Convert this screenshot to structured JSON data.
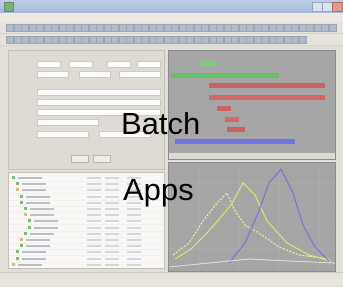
{
  "overlay": {
    "line1": "Batch",
    "line2": "Apps"
  },
  "colors": {
    "gantt_bars": [
      "#2fbf2f",
      "#1aa51a",
      "#b01818",
      "#c42020",
      "#b51c1c",
      "#c11f1f",
      "#b41a1a",
      "#2832d8"
    ],
    "plot_series": [
      "#ffff66",
      "#dddd22",
      "#2a2acc",
      "#e0e0e0"
    ],
    "window_title": "#8aa3d3"
  },
  "icons": [
    "app-icon",
    "minimize-icon",
    "maximize-icon",
    "close-icon",
    "tree-node-icon"
  ]
}
